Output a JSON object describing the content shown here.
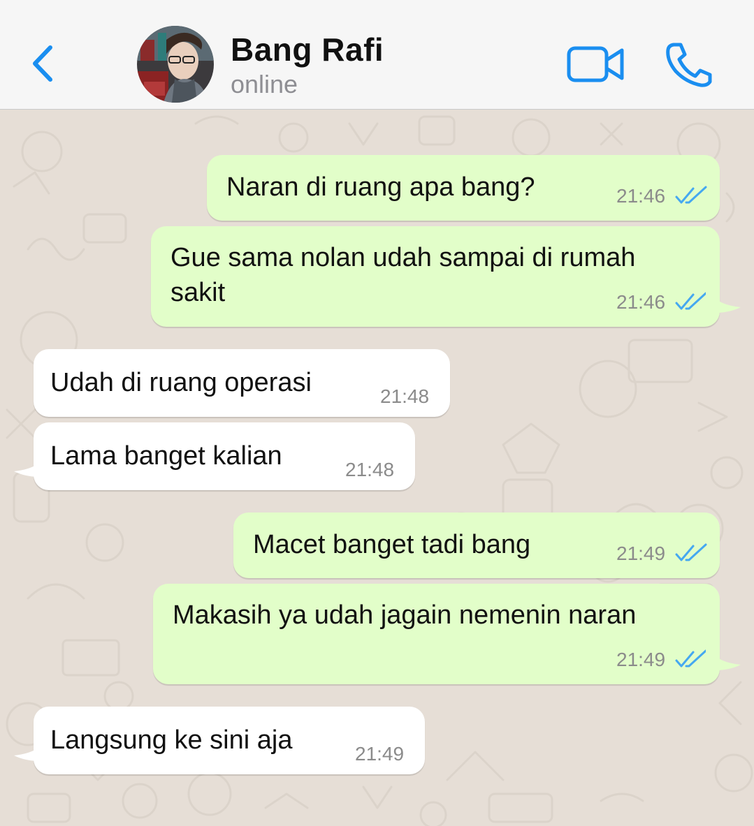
{
  "header": {
    "back_icon": "chevron-left-icon",
    "contact_name": "Bang Rafi",
    "status": "online",
    "video_icon": "video-camera-icon",
    "call_icon": "phone-icon",
    "accent_color": "#1a8ef0"
  },
  "messages": [
    {
      "direction": "outgoing",
      "text": "Naran di ruang apa bang?",
      "time": "21:46",
      "status": "read"
    },
    {
      "direction": "outgoing",
      "lines": [
        "Gue sama nolan udah sampai di rumah",
        "sakit"
      ],
      "time": "21:46",
      "status": "read"
    },
    {
      "direction": "incoming",
      "text": "Udah di ruang operasi",
      "time": "21:48"
    },
    {
      "direction": "incoming",
      "text": "Lama banget kalian",
      "time": "21:48"
    },
    {
      "direction": "outgoing",
      "text": "Macet banget tadi bang",
      "time": "21:49",
      "status": "read"
    },
    {
      "direction": "outgoing",
      "text": "Makasih ya udah jagain nemenin naran",
      "time": "21:49",
      "status": "read"
    },
    {
      "direction": "incoming",
      "text": "Langsung ke sini aja",
      "time": "21:49"
    }
  ],
  "colors": {
    "outgoing_bubble": "#e2fec9",
    "incoming_bubble": "#ffffff",
    "read_ticks": "#45a8f0",
    "chat_background": "#e6ded6"
  }
}
